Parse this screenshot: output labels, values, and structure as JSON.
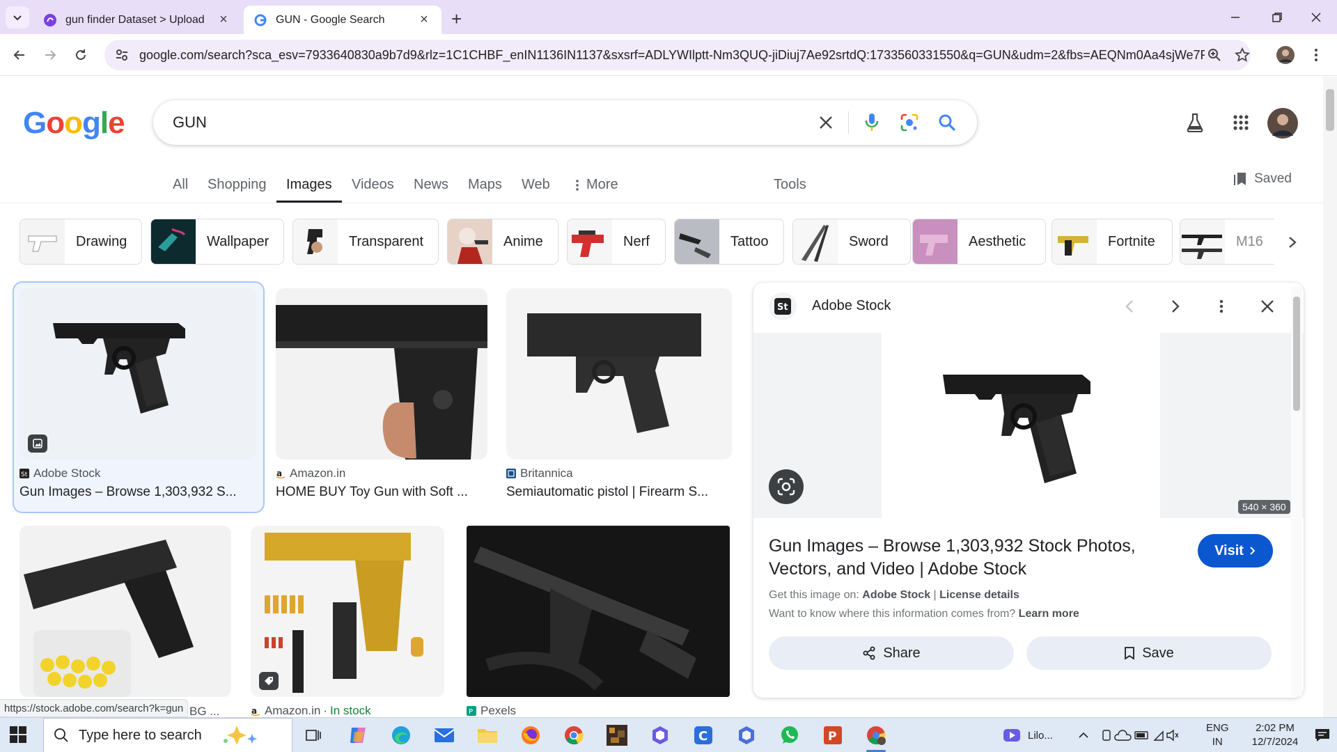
{
  "browser": {
    "tabs": [
      {
        "title": "gun finder Dataset > Upload"
      },
      {
        "title": "GUN - Google Search"
      }
    ],
    "url": "google.com/search?sca_esv=7933640830a9b7d9&rlz=1C1CHBF_enIN1136IN1137&sxsrf=ADLYWIlptt-Nm3QUQ-jiDiuj7Ae92srtdQ:1733560331550&q=GUN&udm=2&fbs=AEQNm0Aa4sjWe7Rqy3..."
  },
  "google": {
    "logo": {
      "G": "G",
      "o1": "o",
      "o2": "o",
      "g": "g",
      "l": "l",
      "e": "e"
    },
    "query": "GUN",
    "tabs": [
      "All",
      "Shopping",
      "Images",
      "Videos",
      "News",
      "Maps",
      "Web",
      "More",
      "Tools"
    ],
    "active_tab": "Images",
    "saved_label": "Saved",
    "colors": {
      "blue": "#4285F4",
      "red": "#EA4335",
      "yellow": "#FBBC05",
      "green": "#34A853"
    }
  },
  "chips": [
    "Drawing",
    "Wallpaper",
    "Transparent",
    "Anime",
    "Nerf",
    "Tattoo",
    "Sword",
    "Aesthetic",
    "Fortnite",
    "M16"
  ],
  "results": [
    {
      "source": "Adobe Stock",
      "caption": "Gun Images – Browse 1,303,932 S..."
    },
    {
      "source": "Amazon.in",
      "caption": "HOME BUY Toy Gun with Soft ..."
    },
    {
      "source": "Britannica",
      "caption": "Semiautomatic pistol | Firearm S..."
    },
    {
      "source": "BG ..."
    },
    {
      "source": "Amazon.in",
      "badge": "In stock"
    },
    {
      "source": "Pexels"
    }
  ],
  "panel": {
    "source": "Adobe Stock",
    "dimensions": "540 × 360",
    "title_line1": "Gun Images – Browse 1,303,932 Stock Photos,",
    "title_line2": "Vectors, and Video | Adobe Stock",
    "visit_label": "Visit",
    "get_image_prefix": "Get this image on:",
    "get_image_source": "Adobe Stock",
    "separator": "|",
    "license_label": "License details",
    "info_text": "Want to know where this information comes from?",
    "learn_more": "Learn more",
    "share_label": "Share",
    "save_label": "Save"
  },
  "status_url": "https://stock.adobe.com/search?k=gun",
  "taskbar": {
    "search_placeholder": "Type here to search",
    "media_title": "Lilo...",
    "lang_top": "ENG",
    "lang_bottom": "IN",
    "time": "2:02 PM",
    "date": "12/7/2024"
  }
}
